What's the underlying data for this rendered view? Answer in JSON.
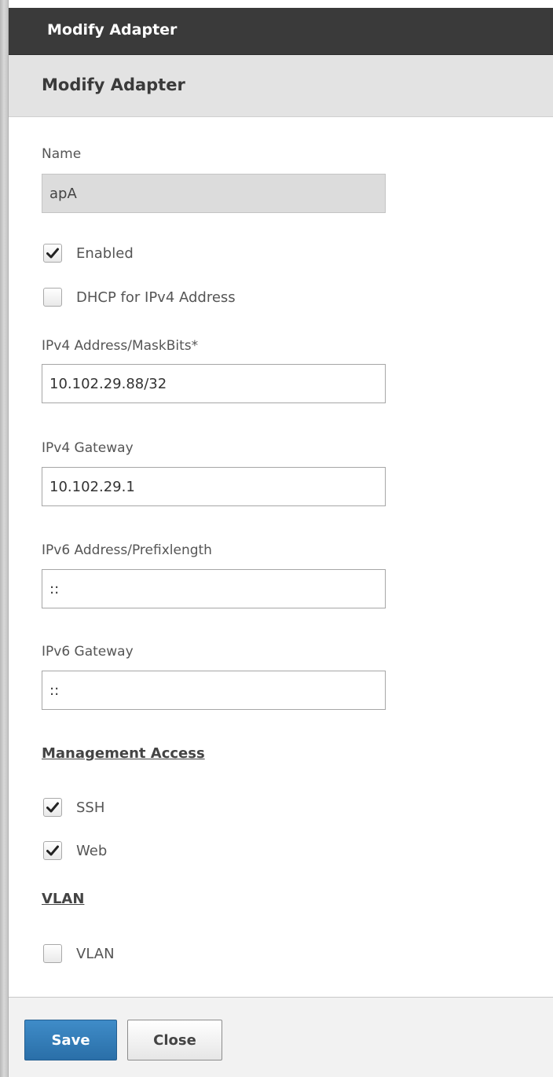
{
  "window": {
    "title": "Modify Adapter"
  },
  "form": {
    "heading": "Modify Adapter",
    "name": {
      "label": "Name",
      "value": "apA"
    },
    "enabled": {
      "label": "Enabled",
      "checked": true
    },
    "dhcp": {
      "label": "DHCP for IPv4 Address",
      "checked": false
    },
    "ipv4_address": {
      "label": "IPv4 Address/MaskBits*",
      "value": "10.102.29.88/32"
    },
    "ipv4_gateway": {
      "label": "IPv4 Gateway",
      "value": "10.102.29.1"
    },
    "ipv6_address": {
      "label": "IPv6 Address/Prefixlength",
      "value": "::"
    },
    "ipv6_gateway": {
      "label": "IPv6 Gateway",
      "value": "::"
    }
  },
  "management_access": {
    "heading": "Management Access",
    "ssh": {
      "label": "SSH",
      "checked": true
    },
    "web": {
      "label": "Web",
      "checked": true
    }
  },
  "vlan": {
    "heading": "VLAN",
    "option": {
      "label": "VLAN",
      "checked": false
    }
  },
  "footer": {
    "save_label": "Save",
    "close_label": "Close"
  },
  "icons": {
    "checkmark": "checkmark-icon"
  },
  "colors": {
    "titlebar_bg": "#3a3a3a",
    "subheader_bg": "#e3e3e3",
    "primary_button": "#2f7dbd",
    "disabled_input_bg": "#dcdcdc"
  }
}
